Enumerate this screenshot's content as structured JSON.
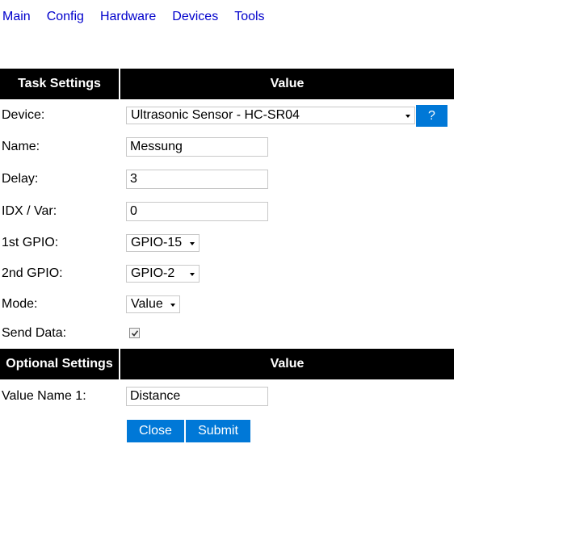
{
  "nav": {
    "items": [
      "Main",
      "Config",
      "Hardware",
      "Devices",
      "Tools"
    ]
  },
  "task_header": {
    "col1": "Task Settings",
    "col2": "Value"
  },
  "fields": {
    "device": {
      "label": "Device:",
      "value": "Ultrasonic Sensor - HC-SR04",
      "help": "?"
    },
    "name": {
      "label": "Name:",
      "value": "Messung"
    },
    "delay": {
      "label": "Delay:",
      "value": "3"
    },
    "idx": {
      "label": "IDX / Var:",
      "value": "0"
    },
    "gpio1": {
      "label": "1st GPIO:",
      "value": "GPIO-15"
    },
    "gpio2": {
      "label": "2nd GPIO:",
      "value": "GPIO-2"
    },
    "mode": {
      "label": "Mode:",
      "value": "Value"
    },
    "send_data": {
      "label": "Send Data:",
      "checked": true
    }
  },
  "optional_header": {
    "col1": "Optional Settings",
    "col2": "Value"
  },
  "optional": {
    "value_name_1": {
      "label": "Value Name 1:",
      "value": "Distance"
    }
  },
  "buttons": {
    "close": "Close",
    "submit": "Submit"
  },
  "colors": {
    "accent": "#0078d7",
    "header_bg": "#000000",
    "link": "#0000cc"
  }
}
